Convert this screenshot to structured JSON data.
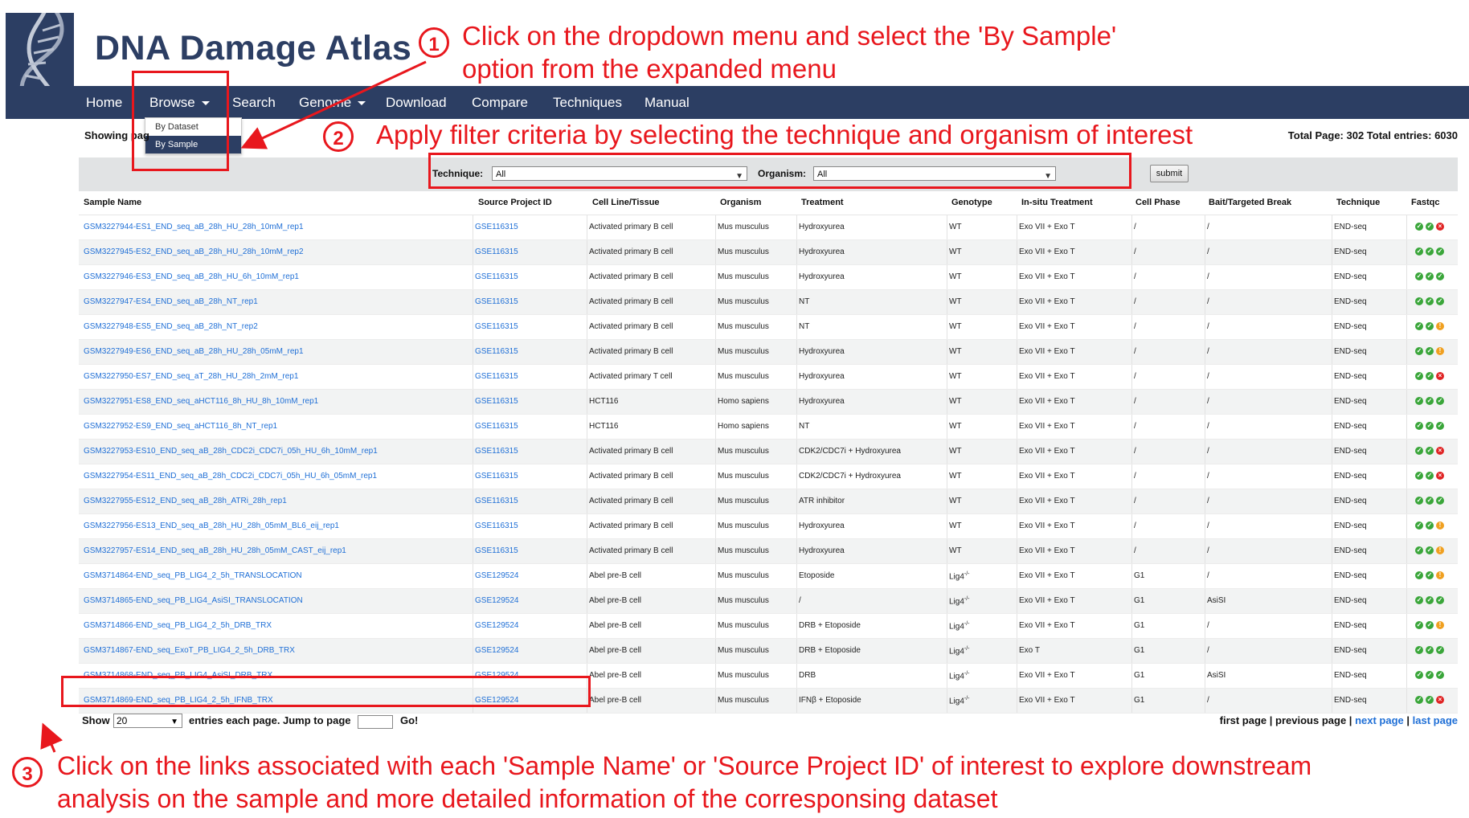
{
  "site": {
    "title": "DNA Damage Atlas"
  },
  "nav": {
    "items": [
      "Home",
      "Browse",
      "Search",
      "Genome",
      "Download",
      "Compare",
      "Techniques",
      "Manual"
    ],
    "browse_dropdown": [
      "By Dataset",
      "By Sample"
    ]
  },
  "status": {
    "showing_prefix": "Showing pag",
    "total": "Total Page: 302 Total entries: 6030"
  },
  "filter": {
    "technique_label": "Technique:",
    "technique_value": "All",
    "organism_label": "Organism:",
    "organism_value": "All",
    "submit_label": "submit"
  },
  "table": {
    "columns": [
      "Sample Name",
      "Source Project ID",
      "Cell Line/Tissue",
      "Organism",
      "Treatment",
      "Genotype",
      "In-situ Treatment",
      "Cell Phase",
      "Bait/Targeted Break",
      "Technique",
      "Fastqc"
    ],
    "rows": [
      {
        "sample": "GSM3227944-ES1_END_seq_aB_28h_HU_28h_10mM_rep1",
        "project": "GSE116315",
        "cell": "Activated primary B cell",
        "organism": "Mus musculus",
        "treatment": "Hydroxyurea",
        "genotype": "WT",
        "insitu": "Exo VII + Exo T",
        "phase": "/",
        "bait": "/",
        "technique": "END-seq",
        "qc": [
          "green",
          "green",
          "red"
        ]
      },
      {
        "sample": "GSM3227945-ES2_END_seq_aB_28h_HU_28h_10mM_rep2",
        "project": "GSE116315",
        "cell": "Activated primary B cell",
        "organism": "Mus musculus",
        "treatment": "Hydroxyurea",
        "genotype": "WT",
        "insitu": "Exo VII + Exo T",
        "phase": "/",
        "bait": "/",
        "technique": "END-seq",
        "qc": [
          "green",
          "green",
          "green"
        ]
      },
      {
        "sample": "GSM3227946-ES3_END_seq_aB_28h_HU_6h_10mM_rep1",
        "project": "GSE116315",
        "cell": "Activated primary B cell",
        "organism": "Mus musculus",
        "treatment": "Hydroxyurea",
        "genotype": "WT",
        "insitu": "Exo VII + Exo T",
        "phase": "/",
        "bait": "/",
        "technique": "END-seq",
        "qc": [
          "green",
          "green",
          "green"
        ]
      },
      {
        "sample": "GSM3227947-ES4_END_seq_aB_28h_NT_rep1",
        "project": "GSE116315",
        "cell": "Activated primary B cell",
        "organism": "Mus musculus",
        "treatment": "NT",
        "genotype": "WT",
        "insitu": "Exo VII + Exo T",
        "phase": "/",
        "bait": "/",
        "technique": "END-seq",
        "qc": [
          "green",
          "green",
          "green"
        ]
      },
      {
        "sample": "GSM3227948-ES5_END_seq_aB_28h_NT_rep2",
        "project": "GSE116315",
        "cell": "Activated primary B cell",
        "organism": "Mus musculus",
        "treatment": "NT",
        "genotype": "WT",
        "insitu": "Exo VII + Exo T",
        "phase": "/",
        "bait": "/",
        "technique": "END-seq",
        "qc": [
          "green",
          "green",
          "orange"
        ]
      },
      {
        "sample": "GSM3227949-ES6_END_seq_aB_28h_HU_28h_05mM_rep1",
        "project": "GSE116315",
        "cell": "Activated primary B cell",
        "organism": "Mus musculus",
        "treatment": "Hydroxyurea",
        "genotype": "WT",
        "insitu": "Exo VII + Exo T",
        "phase": "/",
        "bait": "/",
        "technique": "END-seq",
        "qc": [
          "green",
          "green",
          "orange"
        ]
      },
      {
        "sample": "GSM3227950-ES7_END_seq_aT_28h_HU_28h_2mM_rep1",
        "project": "GSE116315",
        "cell": "Activated primary T cell",
        "organism": "Mus musculus",
        "treatment": "Hydroxyurea",
        "genotype": "WT",
        "insitu": "Exo VII + Exo T",
        "phase": "/",
        "bait": "/",
        "technique": "END-seq",
        "qc": [
          "green",
          "green",
          "red"
        ]
      },
      {
        "sample": "GSM3227951-ES8_END_seq_aHCT116_8h_HU_8h_10mM_rep1",
        "project": "GSE116315",
        "cell": "HCT116",
        "organism": "Homo sapiens",
        "treatment": "Hydroxyurea",
        "genotype": "WT",
        "insitu": "Exo VII + Exo T",
        "phase": "/",
        "bait": "/",
        "technique": "END-seq",
        "qc": [
          "green",
          "green",
          "green"
        ]
      },
      {
        "sample": "GSM3227952-ES9_END_seq_aHCT116_8h_NT_rep1",
        "project": "GSE116315",
        "cell": "HCT116",
        "organism": "Homo sapiens",
        "treatment": "NT",
        "genotype": "WT",
        "insitu": "Exo VII + Exo T",
        "phase": "/",
        "bait": "/",
        "technique": "END-seq",
        "qc": [
          "green",
          "green",
          "green"
        ]
      },
      {
        "sample": "GSM3227953-ES10_END_seq_aB_28h_CDC2i_CDC7i_05h_HU_6h_10mM_rep1",
        "project": "GSE116315",
        "cell": "Activated primary B cell",
        "organism": "Mus musculus",
        "treatment": "CDK2/CDC7i + Hydroxyurea",
        "genotype": "WT",
        "insitu": "Exo VII + Exo T",
        "phase": "/",
        "bait": "/",
        "technique": "END-seq",
        "qc": [
          "green",
          "green",
          "red"
        ]
      },
      {
        "sample": "GSM3227954-ES11_END_seq_aB_28h_CDC2i_CDC7i_05h_HU_6h_05mM_rep1",
        "project": "GSE116315",
        "cell": "Activated primary B cell",
        "organism": "Mus musculus",
        "treatment": "CDK2/CDC7i + Hydroxyurea",
        "genotype": "WT",
        "insitu": "Exo VII + Exo T",
        "phase": "/",
        "bait": "/",
        "technique": "END-seq",
        "qc": [
          "green",
          "green",
          "red"
        ]
      },
      {
        "sample": "GSM3227955-ES12_END_seq_aB_28h_ATRi_28h_rep1",
        "project": "GSE116315",
        "cell": "Activated primary B cell",
        "organism": "Mus musculus",
        "treatment": "ATR inhibitor",
        "genotype": "WT",
        "insitu": "Exo VII + Exo T",
        "phase": "/",
        "bait": "/",
        "technique": "END-seq",
        "qc": [
          "green",
          "green",
          "green"
        ]
      },
      {
        "sample": "GSM3227956-ES13_END_seq_aB_28h_HU_28h_05mM_BL6_eij_rep1",
        "project": "GSE116315",
        "cell": "Activated primary B cell",
        "organism": "Mus musculus",
        "treatment": "Hydroxyurea",
        "genotype": "WT",
        "insitu": "Exo VII + Exo T",
        "phase": "/",
        "bait": "/",
        "technique": "END-seq",
        "qc": [
          "green",
          "green",
          "orange"
        ]
      },
      {
        "sample": "GSM3227957-ES14_END_seq_aB_28h_HU_28h_05mM_CAST_eij_rep1",
        "project": "GSE116315",
        "cell": "Activated primary B cell",
        "organism": "Mus musculus",
        "treatment": "Hydroxyurea",
        "genotype": "WT",
        "insitu": "Exo VII + Exo T",
        "phase": "/",
        "bait": "/",
        "technique": "END-seq",
        "qc": [
          "green",
          "green",
          "orange"
        ]
      },
      {
        "sample": "GSM3714864-END_seq_PB_LIG4_2_5h_TRANSLOCATION",
        "project": "GSE129524",
        "cell": "Abel pre-B cell",
        "organism": "Mus musculus",
        "treatment": "Etoposide",
        "genotype": "Lig4",
        "genotype_sup": "-/-",
        "insitu": "Exo VII + Exo T",
        "phase": "G1",
        "bait": "/",
        "technique": "END-seq",
        "qc": [
          "green",
          "green",
          "orange"
        ]
      },
      {
        "sample": "GSM3714865-END_seq_PB_LIG4_AsiSI_TRANSLOCATION",
        "project": "GSE129524",
        "cell": "Abel pre-B cell",
        "organism": "Mus musculus",
        "treatment": "/",
        "genotype": "Lig4",
        "genotype_sup": "-/-",
        "insitu": "Exo VII + Exo T",
        "phase": "G1",
        "bait": "AsiSI",
        "technique": "END-seq",
        "qc": [
          "green",
          "green",
          "green"
        ]
      },
      {
        "sample": "GSM3714866-END_seq_PB_LIG4_2_5h_DRB_TRX",
        "project": "GSE129524",
        "cell": "Abel pre-B cell",
        "organism": "Mus musculus",
        "treatment": "DRB + Etoposide",
        "genotype": "Lig4",
        "genotype_sup": "-/-",
        "insitu": "Exo VII + Exo T",
        "phase": "G1",
        "bait": "/",
        "technique": "END-seq",
        "qc": [
          "green",
          "green",
          "orange"
        ]
      },
      {
        "sample": "GSM3714867-END_seq_ExoT_PB_LIG4_2_5h_DRB_TRX",
        "project": "GSE129524",
        "cell": "Abel pre-B cell",
        "organism": "Mus musculus",
        "treatment": "DRB + Etoposide",
        "genotype": "Lig4",
        "genotype_sup": "-/-",
        "insitu": "Exo T",
        "phase": "G1",
        "bait": "/",
        "technique": "END-seq",
        "qc": [
          "green",
          "green",
          "green"
        ]
      },
      {
        "sample": "GSM3714868-END_seq_PB_LIG4_AsiSI_DRB_TRX",
        "project": "GSE129524",
        "cell": "Abel pre-B cell",
        "organism": "Mus musculus",
        "treatment": "DRB",
        "genotype": "Lig4",
        "genotype_sup": "-/-",
        "insitu": "Exo VII + Exo T",
        "phase": "G1",
        "bait": "AsiSI",
        "technique": "END-seq",
        "qc": [
          "green",
          "green",
          "green"
        ]
      },
      {
        "sample": "GSM3714869-END_seq_PB_LIG4_2_5h_IFNB_TRX",
        "project": "GSE129524",
        "cell": "Abel pre-B cell",
        "organism": "Mus musculus",
        "treatment": "IFNβ + Etoposide",
        "genotype": "Lig4",
        "genotype_sup": "-/-",
        "insitu": "Exo VII + Exo T",
        "phase": "G1",
        "bait": "/",
        "technique": "END-seq",
        "qc": [
          "green",
          "green",
          "red"
        ]
      }
    ]
  },
  "bottom": {
    "show_label": "Show",
    "show_value": "20",
    "entries_label": "entries each page.",
    "jump_label": "Jump to page",
    "go_label": "Go!",
    "first_page": "first page",
    "previous_page": "previous page",
    "next_page": "next page",
    "last_page": "last page",
    "sep": "|"
  },
  "annotations": {
    "step1_num": "1",
    "step1_line1": "Click on the dropdown menu and select the 'By Sample'",
    "step1_line2": "option from the expanded menu",
    "step2_num": "2",
    "step2_text": "Apply filter criteria by selecting the technique and organism of interest",
    "step3_num": "3",
    "step3_line1": "Click on the links associated with each 'Sample Name' or 'Source Project ID' of interest to explore downstream",
    "step3_line2": "analysis on the sample and more detailed information of the corresponsing dataset"
  },
  "colors": {
    "nav_bg": "#2c3e63",
    "annotation_red": "#e8171d",
    "link_blue": "#1f6fd6",
    "qc_green": "#3aa63a",
    "qc_red": "#e02424",
    "qc_orange": "#f0a020"
  }
}
